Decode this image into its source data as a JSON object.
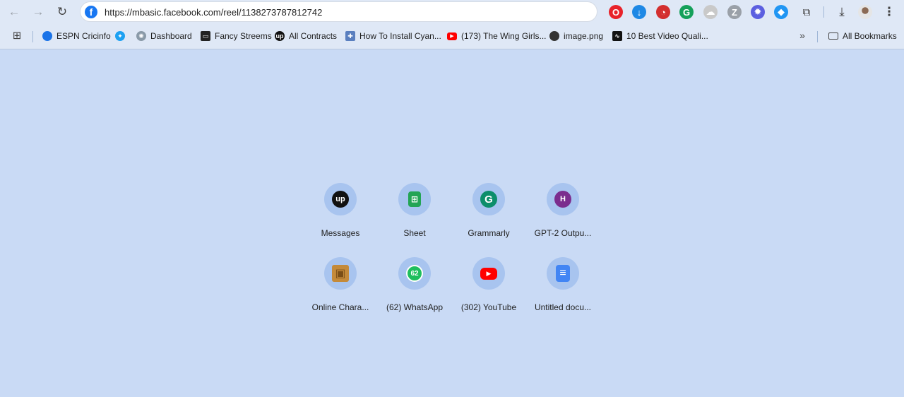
{
  "browser": {
    "url": "https://mbasic.facebook.com/reel/1138273787812742",
    "extensions": [
      {
        "name": "opera-ext",
        "glyph": "O",
        "color": "#e8222a"
      },
      {
        "name": "download-ext",
        "glyph": "↓",
        "color": "#1e88e5"
      },
      {
        "name": "speed-ext",
        "glyph": "◔",
        "color": "#d32f2f"
      },
      {
        "name": "grammarly-ext",
        "glyph": "G",
        "color": "#15a05a"
      },
      {
        "name": "cloud-ext",
        "glyph": "☁",
        "color": "#c9c9c9"
      },
      {
        "name": "z-ext",
        "glyph": "Z",
        "color": "#9aa0a8"
      },
      {
        "name": "gear-ext",
        "glyph": "✹",
        "color": "#5b5fe0"
      },
      {
        "name": "shield-ext",
        "glyph": "◆",
        "color": "#2196f3"
      }
    ]
  },
  "bookmarks": {
    "items": [
      {
        "label": "ESPN Cricinfo",
        "icon": "globe-icon",
        "color": "#1a73e8"
      },
      {
        "label": "",
        "icon": "twitter-icon",
        "color": "#1da1f2"
      },
      {
        "label": "Dashboard",
        "icon": "openai-icon",
        "color": "#8a9aa8"
      },
      {
        "label": "Fancy Streems",
        "icon": "tv-icon",
        "color": "#222222"
      },
      {
        "label": "All Contracts",
        "icon": "upwork-icon",
        "color": "#111111"
      },
      {
        "label": "How To Install Cyan...",
        "icon": "puzzle-icon",
        "color": "#5a7fbf"
      },
      {
        "label": "(173) The Wing Girls...",
        "icon": "youtube-icon",
        "color": "#ff0000"
      },
      {
        "label": "image.png",
        "icon": "world-icon",
        "color": "#333333"
      },
      {
        "label": "10 Best Video Quali...",
        "icon": "wave-icon",
        "color": "#111111"
      }
    ],
    "all_bookmarks_label": "All Bookmarks"
  },
  "shortcuts": [
    {
      "label": "Messages",
      "icon": "upwork-icon",
      "glyph": "up",
      "color": "#111111"
    },
    {
      "label": "Sheet",
      "icon": "sheets-icon",
      "glyph": "⊞",
      "color": "#23a455"
    },
    {
      "label": "Grammarly",
      "icon": "grammarly-icon",
      "glyph": "G",
      "color": "#0d8e6b"
    },
    {
      "label": "GPT-2 Outpu...",
      "icon": "h-icon",
      "glyph": "H",
      "color": "#7b2d8e"
    },
    {
      "label": "Online Chara...",
      "icon": "box-icon",
      "glyph": "▣",
      "color": "#c48a3a"
    },
    {
      "label": "(62) WhatsApp",
      "icon": "whatsapp-icon",
      "glyph": "62",
      "color": "#25d366"
    },
    {
      "label": "(302) YouTube",
      "icon": "youtube-icon",
      "glyph": "▶",
      "color": "#ff0000"
    },
    {
      "label": "Untitled docu...",
      "icon": "docs-icon",
      "glyph": "≡",
      "color": "#4285f4"
    }
  ]
}
